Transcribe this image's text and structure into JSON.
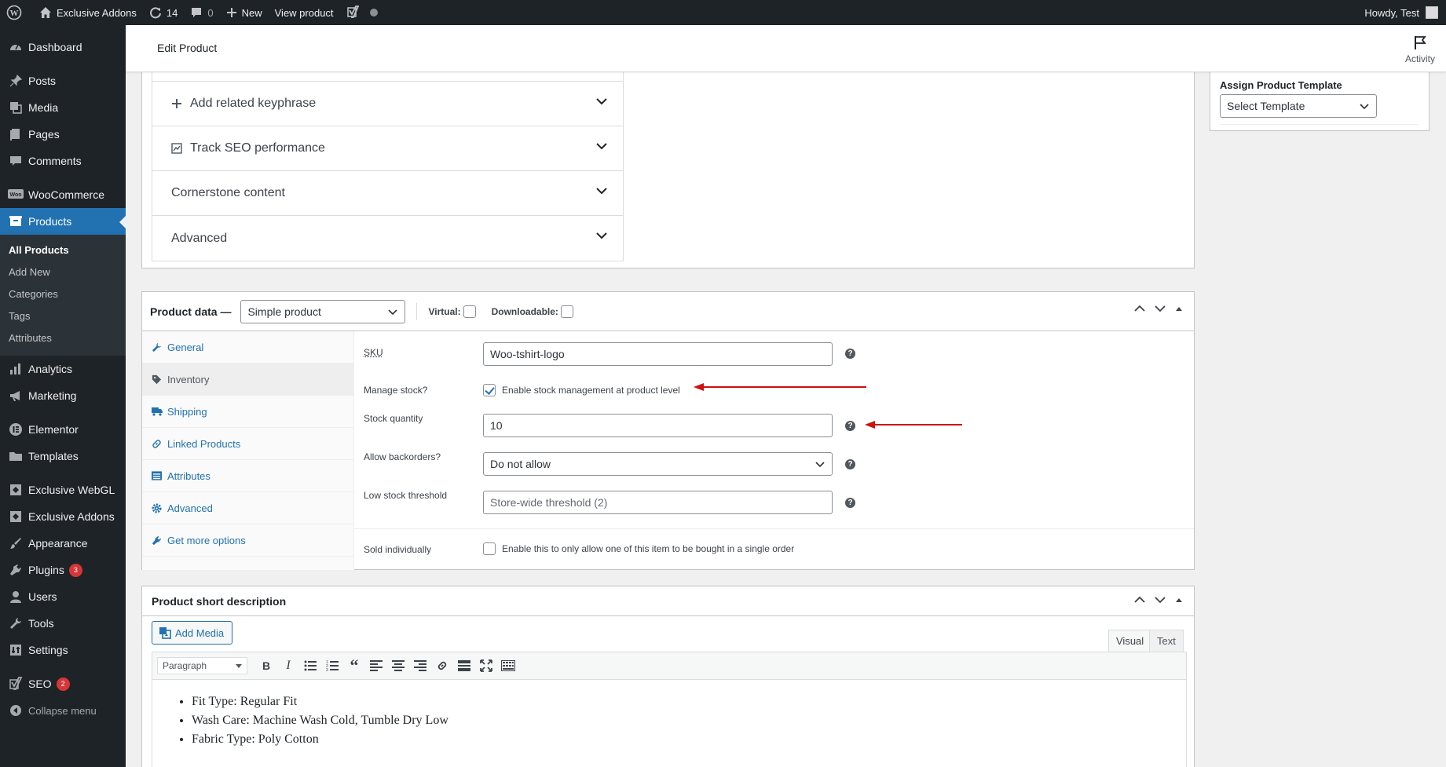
{
  "adminbar": {
    "site_name": "Exclusive Addons",
    "updates_count": "14",
    "comments_count": "0",
    "new_label": "New",
    "view_label": "View product",
    "howdy": "Howdy, Test"
  },
  "sidebar": {
    "dashboard": "Dashboard",
    "posts": "Posts",
    "media": "Media",
    "pages": "Pages",
    "comments": "Comments",
    "woocommerce": "WooCommerce",
    "products": "Products",
    "sub_all": "All Products",
    "sub_add": "Add New",
    "sub_categories": "Categories",
    "sub_tags": "Tags",
    "sub_attributes": "Attributes",
    "analytics": "Analytics",
    "marketing": "Marketing",
    "elementor": "Elementor",
    "templates": "Templates",
    "webgl": "Exclusive WebGL",
    "addons": "Exclusive Addons",
    "appearance": "Appearance",
    "plugins": "Plugins",
    "plugins_badge": "3",
    "users": "Users",
    "tools": "Tools",
    "settings": "Settings",
    "seo": "SEO",
    "seo_badge": "2",
    "collapse": "Collapse menu"
  },
  "header": {
    "title": "Edit Product",
    "activity": "Activity"
  },
  "seo_accordion": {
    "related": "Add related keyphrase",
    "track": "Track SEO performance",
    "cornerstone": "Cornerstone content",
    "advanced": "Advanced"
  },
  "template_box": {
    "label": "Assign Product Template",
    "value": "Select Template"
  },
  "product_data": {
    "heading": "Product data —",
    "type_value": "Simple product",
    "virtual_label": "Virtual:",
    "downloadable_label": "Downloadable:",
    "tabs": {
      "general": "General",
      "inventory": "Inventory",
      "shipping": "Shipping",
      "linked": "Linked Products",
      "attributes": "Attributes",
      "advanced": "Advanced",
      "more": "Get more options"
    },
    "fields": {
      "sku_label": "SKU",
      "sku_value": "Woo-tshirt-logo",
      "manage_label": "Manage stock?",
      "manage_text": "Enable stock management at product level",
      "qty_label": "Stock quantity",
      "qty_value": "10",
      "backorders_label": "Allow backorders?",
      "backorders_value": "Do not allow",
      "threshold_label": "Low stock threshold",
      "threshold_placeholder": "Store-wide threshold (2)",
      "sold_label": "Sold individually",
      "sold_text": "Enable this to only allow one of this item to be bought in a single order"
    }
  },
  "short_description": {
    "heading": "Product short description",
    "add_media": "Add Media",
    "tab_visual": "Visual",
    "tab_text": "Text",
    "format": "Paragraph",
    "items": [
      "Fit Type: Regular Fit",
      "Wash Care: Machine Wash Cold, Tumble Dry Low",
      "Fabric Type: Poly Cotton"
    ]
  },
  "colors": {
    "admin_dark": "#1d2327",
    "accent": "#2271b1",
    "annotation_arrow": "#cc1111"
  }
}
